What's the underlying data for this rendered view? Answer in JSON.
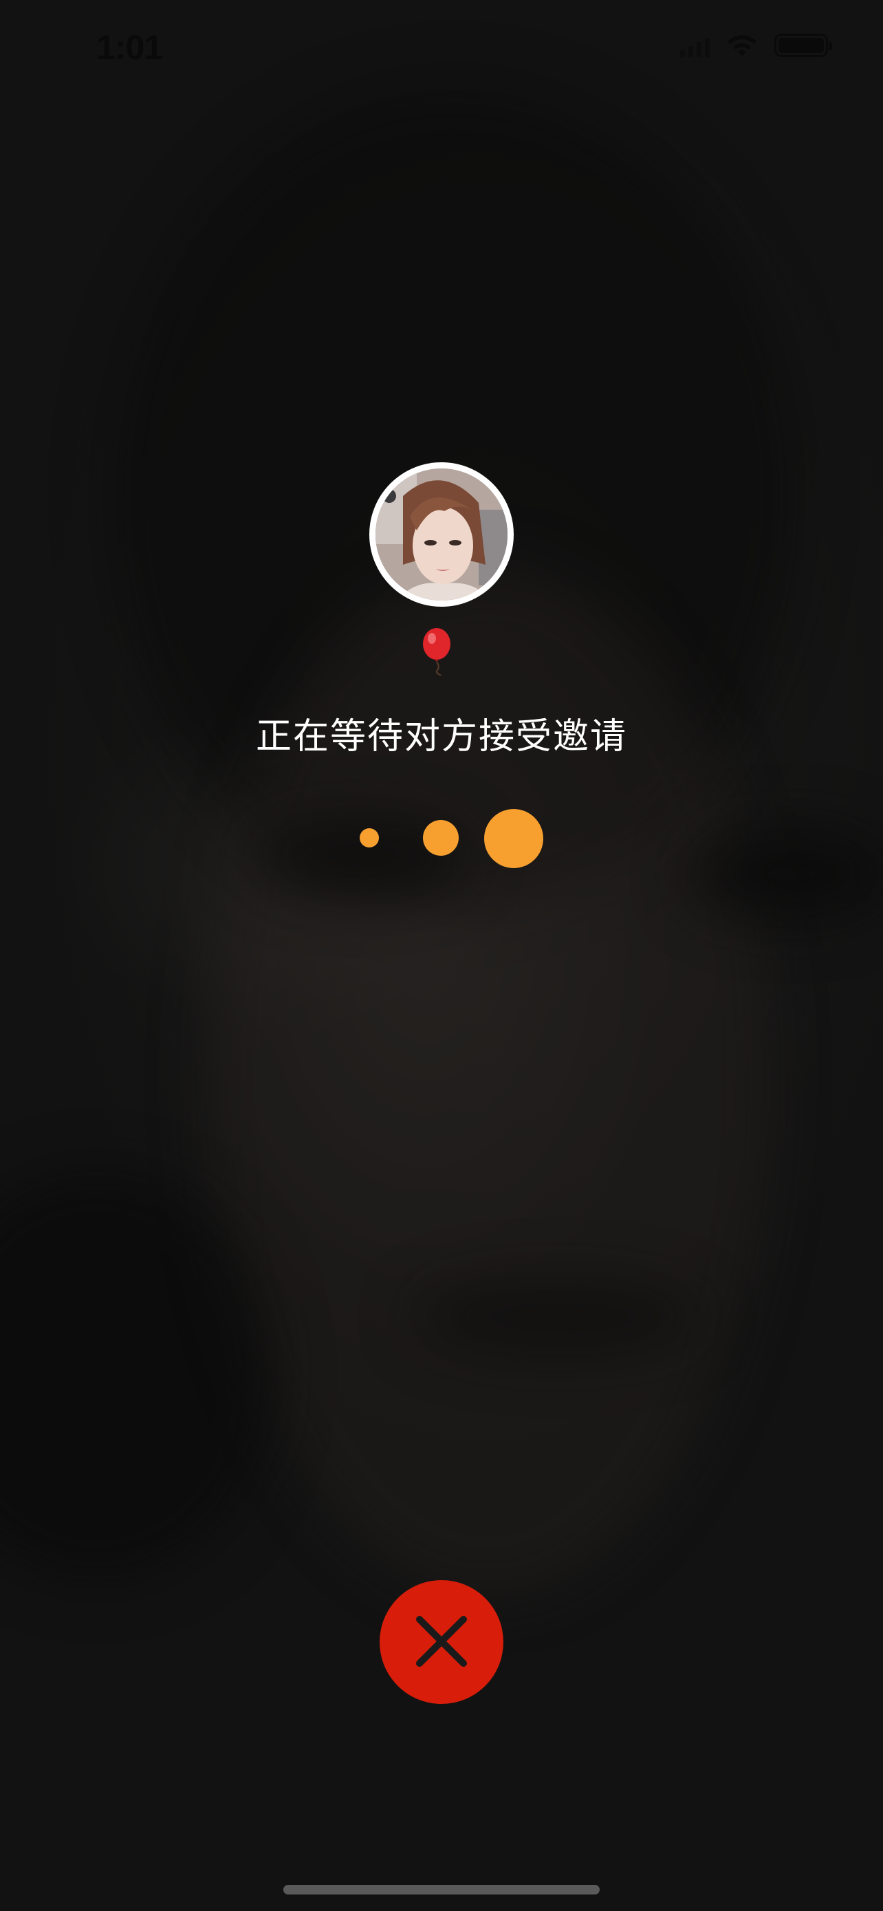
{
  "status_bar": {
    "time": "1:01",
    "icons": [
      "cellular-signal-icon",
      "wifi-icon",
      "battery-icon"
    ]
  },
  "call": {
    "avatar": "contact-avatar",
    "balloon_icon": "red-balloon-icon",
    "waiting_text": "正在等待对方接受邀请",
    "loading_dots": 3,
    "hangup_icon": "close-icon"
  },
  "colors": {
    "background": "#141414",
    "dot_accent": "#f7a030",
    "hangup_red": "#d81e0a",
    "text": "#ffffff"
  }
}
